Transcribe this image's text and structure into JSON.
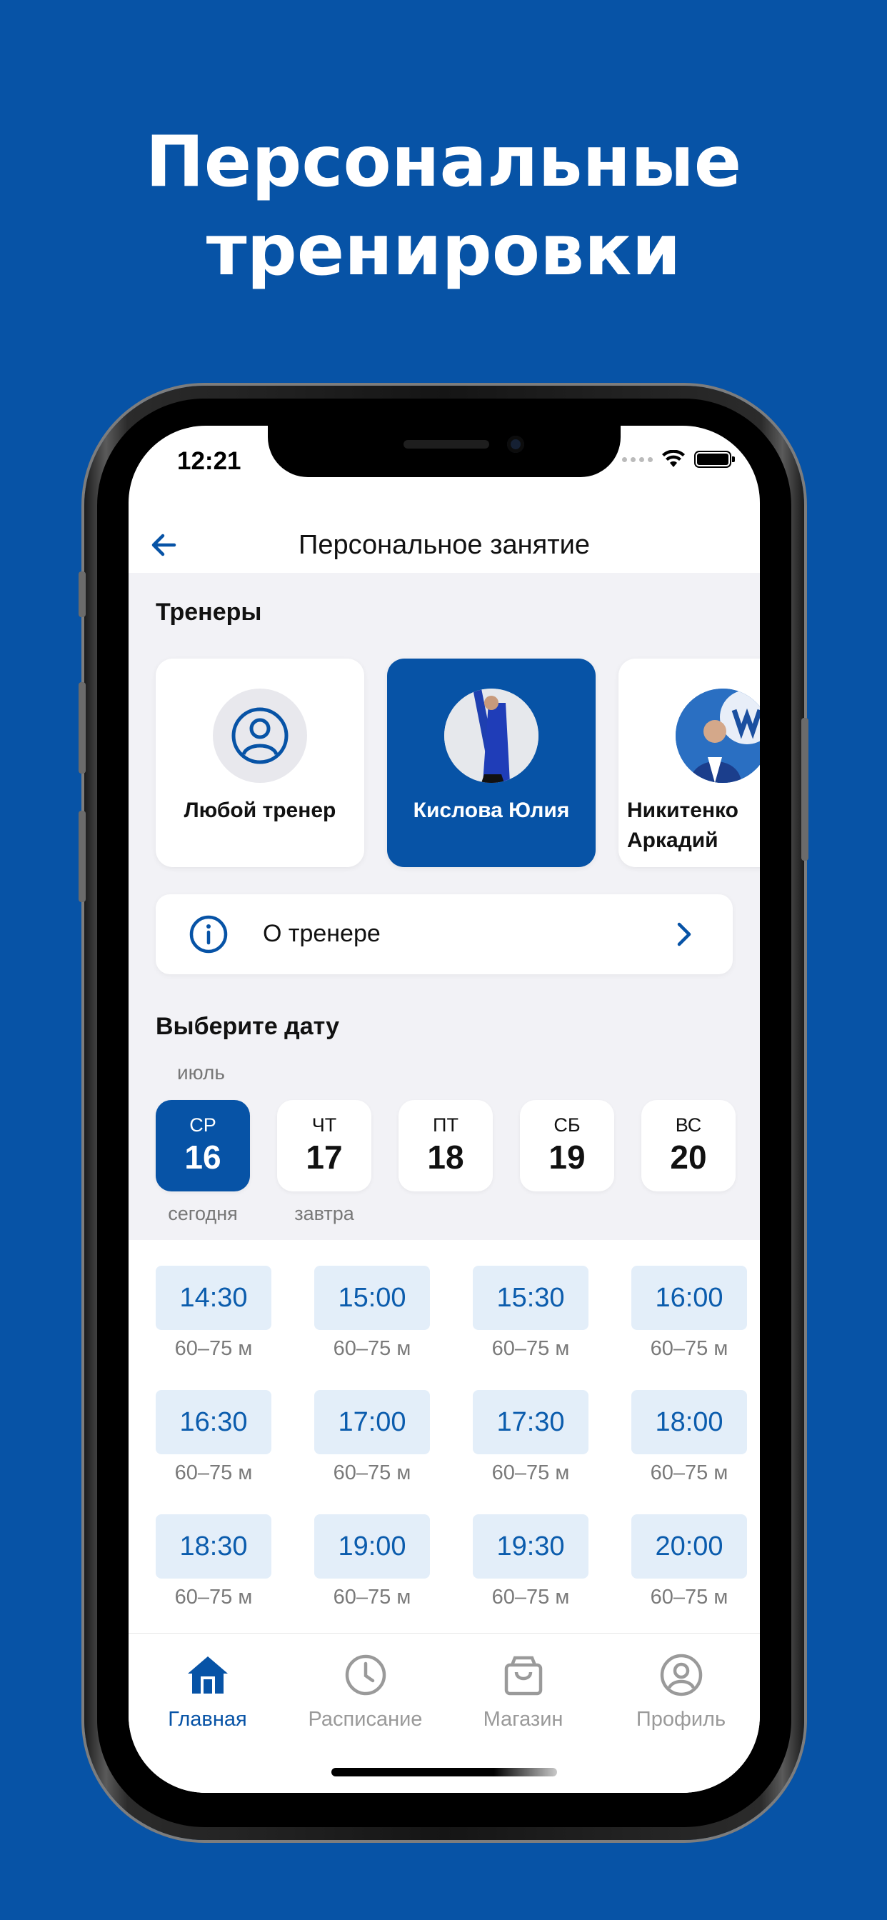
{
  "headline": {
    "line1": "Персональные",
    "line2": "тренировки"
  },
  "status": {
    "time": "12:21"
  },
  "nav": {
    "title": "Персональное занятие"
  },
  "trainers": {
    "title": "Тренеры",
    "items": [
      {
        "name": "Любой тренер",
        "selected": false
      },
      {
        "name": "Кислова Юлия",
        "selected": true
      },
      {
        "name_line1": "Никитенко",
        "name_line2": "Аркадий",
        "selected": false
      }
    ]
  },
  "about": {
    "label": "О тренере"
  },
  "date": {
    "title": "Выберите дату",
    "month": "июль",
    "days": [
      {
        "dow": "СР",
        "num": "16",
        "caption": "сегодня",
        "selected": true
      },
      {
        "dow": "ЧТ",
        "num": "17",
        "caption": "завтра",
        "selected": false
      },
      {
        "dow": "ПТ",
        "num": "18",
        "caption": "",
        "selected": false
      },
      {
        "dow": "СБ",
        "num": "19",
        "caption": "",
        "selected": false
      },
      {
        "dow": "ВС",
        "num": "20",
        "caption": "",
        "selected": false
      }
    ]
  },
  "slots": [
    {
      "time": "14:30",
      "dur": "60–75 м"
    },
    {
      "time": "15:00",
      "dur": "60–75 м"
    },
    {
      "time": "15:30",
      "dur": "60–75 м"
    },
    {
      "time": "16:00",
      "dur": "60–75 м"
    },
    {
      "time": "16:30",
      "dur": "60–75 м"
    },
    {
      "time": "17:00",
      "dur": "60–75 м"
    },
    {
      "time": "17:30",
      "dur": "60–75 м"
    },
    {
      "time": "18:00",
      "dur": "60–75 м"
    },
    {
      "time": "18:30",
      "dur": "60–75 м"
    },
    {
      "time": "19:00",
      "dur": "60–75 м"
    },
    {
      "time": "19:30",
      "dur": "60–75 м"
    },
    {
      "time": "20:00",
      "dur": "60–75 м"
    }
  ],
  "tabs": [
    {
      "label": "Главная",
      "icon": "home-icon",
      "active": true
    },
    {
      "label": "Расписание",
      "icon": "clock-icon",
      "active": false
    },
    {
      "label": "Магазин",
      "icon": "shopping-bag-icon",
      "active": false
    },
    {
      "label": "Профиль",
      "icon": "profile-icon",
      "active": false
    }
  ],
  "colors": {
    "brand": "#0753a6",
    "slot_bg": "#e3eef9",
    "slot_text": "#0b5cad",
    "page_bg": "#f2f2f6"
  }
}
